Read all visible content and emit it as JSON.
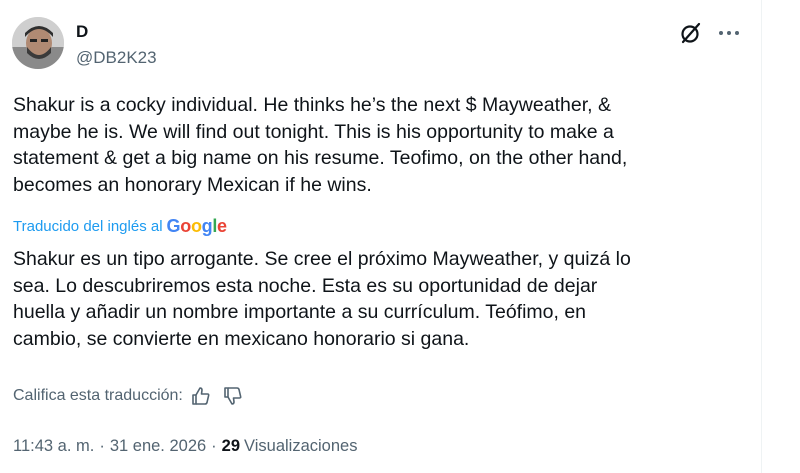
{
  "author": {
    "name": "D",
    "handle": "@DB2K23"
  },
  "tweet": {
    "text": "Shakur is a cocky individual. He thinks he’s the next $ Mayweather, &\nmaybe he is. We will find out tonight. This is his opportunity to make a\nstatement & get a big name on his resume. Teofimo, on the other hand,\nbecomes an honorary Mexican if he wins."
  },
  "translation": {
    "label": "Traducido del inglés al",
    "provider": [
      "G",
      "o",
      "o",
      "g",
      "l",
      "e"
    ],
    "provider_colors": [
      "#4285F4",
      "#EA4335",
      "#FBBC05",
      "#4285F4",
      "#34A853",
      "#EA4335"
    ],
    "text": "Shakur es un tipo arrogante. Se cree el próximo Mayweather, y quizá lo\nsea. Lo descubriremos esta noche. Esta es su oportunidad de dejar\nhuella y añadir un nombre importante a su currículum. Teófimo, en\ncambio, se convierte en mexicano honorario si gana.",
    "rate_label": "Califica esta traducción:"
  },
  "meta": {
    "time": "11:43 a. m.",
    "separator": "·",
    "date": "31 ene. 2026",
    "views_count": "29",
    "views_label": "Visualizaciones"
  },
  "icons": {
    "grok": "grok-icon",
    "more": "more-icon",
    "thumbs_up": "thumbs-up-icon",
    "thumbs_down": "thumbs-down-icon"
  },
  "colors": {
    "text": "#0f1419",
    "secondary": "#536471",
    "link": "#1d9bf0"
  }
}
